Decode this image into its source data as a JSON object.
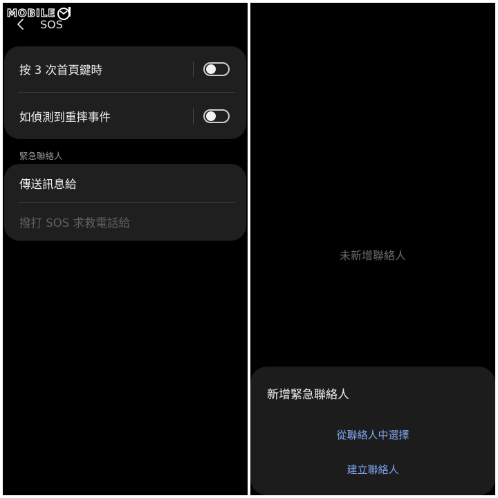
{
  "watermark": {
    "logo_text": "MOBILE01",
    "logo_wordmark": "MOBILE",
    "logo_badge": "01"
  },
  "header": {
    "title": "SOS",
    "back_icon": "chevron-left-icon"
  },
  "settings": {
    "toggles": [
      {
        "label": "按 3 次首頁鍵時",
        "enabled": false
      },
      {
        "label": "如偵測到重摔事件",
        "enabled": false
      }
    ],
    "contacts_section_title": "緊急聯絡人",
    "contacts_items": [
      {
        "label": "傳送訊息給",
        "enabled": true
      },
      {
        "label": "撥打 SOS 求救電話給",
        "enabled": false
      }
    ]
  },
  "contact_picker": {
    "empty_text": "未新增聯絡人",
    "sheet_title": "新增緊急聯絡人",
    "actions": [
      {
        "label": "從聯絡人中選擇"
      },
      {
        "label": "建立聯絡人"
      }
    ]
  },
  "colors": {
    "background": "#000000",
    "card": "#1f1f1f",
    "accent": "#7ea6f2",
    "text_primary": "#eeeeee",
    "text_disabled": "#5f5f5f"
  }
}
